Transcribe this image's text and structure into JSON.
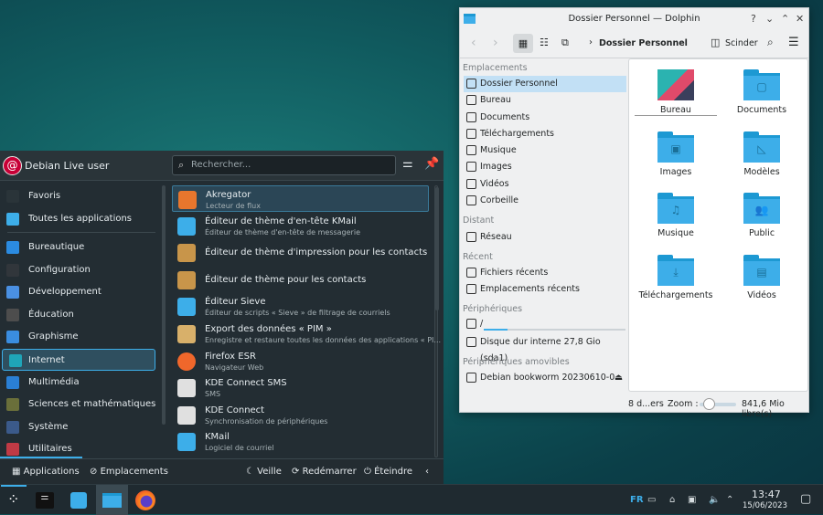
{
  "menu": {
    "user": "Debian Live user",
    "search_placeholder": "Rechercher...",
    "categories": [
      {
        "label": "Favoris",
        "icon": "bookmark-icon",
        "color": "#2a3439"
      },
      {
        "label": "Toutes les applications",
        "icon": "grid-icon",
        "color": "#3daee9"
      },
      {
        "label": "Bureautique",
        "icon": "office-icon",
        "color": "#2b8be0"
      },
      {
        "label": "Configuration",
        "icon": "settings-icon",
        "color": "#31363b"
      },
      {
        "label": "Développement",
        "icon": "development-icon",
        "color": "#4a90e2"
      },
      {
        "label": "Éducation",
        "icon": "education-icon",
        "color": "#4d4d4d"
      },
      {
        "label": "Graphisme",
        "icon": "graphics-icon",
        "color": "#3a8de0"
      },
      {
        "label": "Internet",
        "icon": "globe-icon",
        "color": "#1fa5b8",
        "selected": true
      },
      {
        "label": "Multimédia",
        "icon": "multimedia-icon",
        "color": "#2a7fd4"
      },
      {
        "label": "Sciences et mathématiques",
        "icon": "science-icon",
        "color": "#6a6f3a"
      },
      {
        "label": "Système",
        "icon": "system-icon",
        "color": "#3b5a8a"
      },
      {
        "label": "Utilitaires",
        "icon": "utilities-icon",
        "color": "#c03a45"
      }
    ],
    "apps": [
      {
        "title": "Akregator",
        "subtitle": "Lecteur de flux",
        "icon": "rss-icon",
        "color": "#e8762d",
        "selected": true
      },
      {
        "title": "Éditeur de thème d'en-tête KMail",
        "subtitle": "Éditeur de thème d'en-tête de messagerie",
        "icon": "mail-icon",
        "color": "#3daee9"
      },
      {
        "title": "Éditeur de thème d'impression pour les contacts",
        "subtitle": "",
        "icon": "contacts-icon",
        "color": "#c8954a"
      },
      {
        "title": "Éditeur de thème pour les contacts",
        "subtitle": "",
        "icon": "contacts-icon",
        "color": "#c8954a"
      },
      {
        "title": "Éditeur Sieve",
        "subtitle": "Éditeur de scripts « Sieve » de filtrage de courriels",
        "icon": "mail-icon",
        "color": "#3daee9"
      },
      {
        "title": "Export des données « PIM »",
        "subtitle": "Enregistre et restaure toutes les données des applications « PI...",
        "icon": "archive-icon",
        "color": "#d8b06a"
      },
      {
        "title": "Firefox ESR",
        "subtitle": "Navigateur Web",
        "icon": "firefox-icon",
        "color": "#f0672b"
      },
      {
        "title": "KDE Connect SMS",
        "subtitle": "SMS",
        "icon": "phone-icon",
        "color": "#e0e0e0"
      },
      {
        "title": "KDE Connect",
        "subtitle": "Synchronisation de périphériques",
        "icon": "phone-icon",
        "color": "#e0e0e0"
      },
      {
        "title": "KMail",
        "subtitle": "Logiciel de courriel",
        "icon": "mail-icon",
        "color": "#3daee9"
      }
    ],
    "footer": {
      "applications": "Applications",
      "places": "Emplacements",
      "sleep": "Veille",
      "restart": "Redémarrer",
      "shutdown": "Éteindre"
    }
  },
  "dolphin": {
    "title": "Dossier Personnel — Dolphin",
    "breadcrumb": "Dossier Personnel",
    "split": "Scinder",
    "sections": {
      "places": "Emplacements",
      "remote": "Distant",
      "recent": "Récent",
      "devices": "Périphériques",
      "removable": "Périphériques amovibles"
    },
    "places": [
      {
        "label": "Dossier Personnel",
        "icon": "home-icon",
        "selected": true
      },
      {
        "label": "Bureau",
        "icon": "desktop-icon"
      },
      {
        "label": "Documents",
        "icon": "documents-icon"
      },
      {
        "label": "Téléchargements",
        "icon": "download-icon"
      },
      {
        "label": "Musique",
        "icon": "music-icon"
      },
      {
        "label": "Images",
        "icon": "images-icon"
      },
      {
        "label": "Vidéos",
        "icon": "videos-icon"
      },
      {
        "label": "Corbeille",
        "icon": "trash-icon"
      }
    ],
    "remote": [
      {
        "label": "Réseau",
        "icon": "network-icon"
      }
    ],
    "recent": [
      {
        "label": "Fichiers récents",
        "icon": "recent-files-icon"
      },
      {
        "label": "Emplacements récents",
        "icon": "recent-places-icon"
      }
    ],
    "devices": [
      {
        "label": "/",
        "icon": "drive-icon",
        "usage": 0.17
      },
      {
        "label": "Disque dur interne 27,8 Gio (sda1)",
        "icon": "drive-icon"
      }
    ],
    "removable": [
      {
        "label": "Debian bookworm 20230610-0...",
        "icon": "optical-disc-icon"
      }
    ],
    "files": [
      {
        "label": "Bureau",
        "glyph": ""
      },
      {
        "label": "Documents",
        "glyph": "▢"
      },
      {
        "label": "Images",
        "glyph": "▣"
      },
      {
        "label": "Modèles",
        "glyph": "◺"
      },
      {
        "label": "Musique",
        "glyph": "♫"
      },
      {
        "label": "Public",
        "glyph": "👥"
      },
      {
        "label": "Téléchargements",
        "glyph": "⤓"
      },
      {
        "label": "Vidéos",
        "glyph": "▤"
      }
    ],
    "status": {
      "count": "8 d...ers",
      "zoom_label": "Zoom :",
      "zoom": 0.2,
      "free": "841,6 Mio libre(s)"
    }
  },
  "taskbar": {
    "lang": "FR",
    "time": "13:47",
    "date": "15/06/2023"
  }
}
